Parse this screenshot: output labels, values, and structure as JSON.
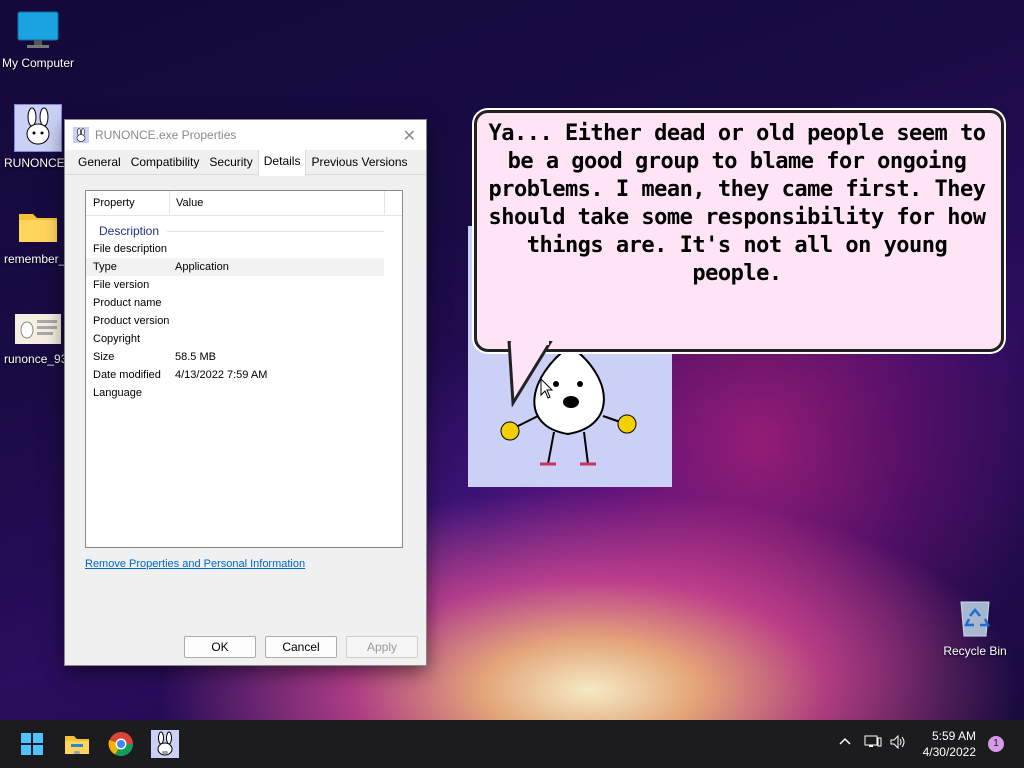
{
  "desktop": {
    "icons": [
      {
        "label": "My Computer"
      },
      {
        "label": "RUNONCE.exe"
      },
      {
        "label": "remember_"
      },
      {
        "label": "runonce_93"
      },
      {
        "label": "Recycle Bin"
      }
    ]
  },
  "window": {
    "title": "RUNONCE.exe Properties",
    "close_glyph": "✕",
    "tabs": [
      "General",
      "Compatibility",
      "Security",
      "Details",
      "Previous Versions"
    ],
    "active_tab": "Details",
    "columns": {
      "property": "Property",
      "value": "Value"
    },
    "group": "Description",
    "rows": [
      {
        "k": "File description",
        "v": ""
      },
      {
        "k": "Type",
        "v": "Application"
      },
      {
        "k": "File version",
        "v": ""
      },
      {
        "k": "Product name",
        "v": ""
      },
      {
        "k": "Product version",
        "v": ""
      },
      {
        "k": "Copyright",
        "v": ""
      },
      {
        "k": "Size",
        "v": "58.5 MB"
      },
      {
        "k": "Date modified",
        "v": "4/13/2022 7:59 AM"
      },
      {
        "k": "Language",
        "v": ""
      }
    ],
    "link": "Remove Properties and Personal Information",
    "buttons": {
      "ok": "OK",
      "cancel": "Cancel",
      "apply": "Apply"
    }
  },
  "speech": {
    "text": "Ya... Either dead or old people seem to be a good group to blame for ongoing problems. I mean, they came first. They should take some responsibility for how things are. It's not all on young people."
  },
  "taskbar": {
    "time": "5:59 AM",
    "date": "4/30/2022",
    "notification_count": "1"
  },
  "colors": {
    "accent": "#0066cc",
    "taskbar": "#1c1c1e",
    "bubble": "#ffe4f6",
    "char_bg": "#cbd0f6"
  }
}
